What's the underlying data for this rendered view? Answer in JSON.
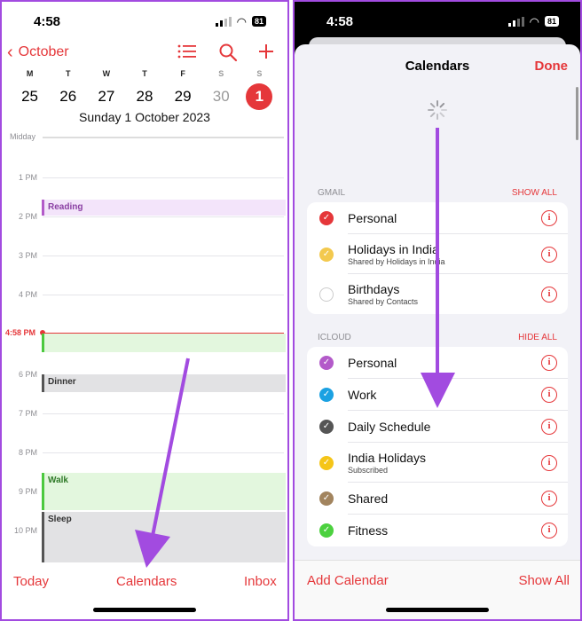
{
  "left": {
    "status": {
      "time": "4:58",
      "battery": "81"
    },
    "nav": {
      "back_label": "October",
      "icons": [
        "list-icon",
        "search-icon",
        "plus-icon"
      ]
    },
    "week": {
      "letters": [
        "M",
        "T",
        "W",
        "T",
        "F",
        "S",
        "S"
      ],
      "days": [
        "25",
        "26",
        "27",
        "28",
        "29",
        "30",
        "1"
      ],
      "selected_index": 6,
      "date_label": "Sunday  1 October 2023"
    },
    "timeline": {
      "hours": [
        "Midday",
        "1 PM",
        "2 PM",
        "3 PM",
        "4 PM",
        "5 PM",
        "6 PM",
        "7 PM",
        "8 PM",
        "9 PM",
        "10 PM"
      ],
      "now_label": "4:58 PM",
      "events": [
        {
          "title": "Reading",
          "color": "#b35ac9",
          "bg": "#f3e4fa"
        },
        {
          "title": "",
          "color": "#4cc93f",
          "bg": "#e3f7de"
        },
        {
          "title": "Dinner",
          "color": "#555555",
          "bg": "#e2e2e4"
        },
        {
          "title": "Walk",
          "color": "#4cc93f",
          "bg": "#e3f7de"
        },
        {
          "title": "Sleep",
          "color": "#555555",
          "bg": "#e2e2e4"
        }
      ]
    },
    "tabbar": {
      "today": "Today",
      "calendars": "Calendars",
      "inbox": "Inbox"
    }
  },
  "right": {
    "status": {
      "time": "4:58",
      "battery": "81"
    },
    "sheet": {
      "title": "Calendars",
      "done": "Done",
      "sections": [
        {
          "name": "GMAIL",
          "action": "SHOW ALL",
          "items": [
            {
              "title": "Personal",
              "subtitle": "",
              "color": "#e5373a",
              "checked": true
            },
            {
              "title": "Holidays in India",
              "subtitle": "Shared by Holidays in India",
              "color": "#f3c94e",
              "checked": true
            },
            {
              "title": "Birthdays",
              "subtitle": "Shared by Contacts",
              "color": "#cccccc",
              "checked": false
            }
          ]
        },
        {
          "name": "ICLOUD",
          "action": "HIDE ALL",
          "items": [
            {
              "title": "Personal",
              "subtitle": "",
              "color": "#b35ac9",
              "checked": true
            },
            {
              "title": "Work",
              "subtitle": "",
              "color": "#1ba1e2",
              "checked": true
            },
            {
              "title": "Daily Schedule",
              "subtitle": "",
              "color": "#555555",
              "checked": true
            },
            {
              "title": "India Holidays",
              "subtitle": "Subscribed",
              "color": "#f5c518",
              "checked": true
            },
            {
              "title": "Shared",
              "subtitle": "",
              "color": "#a2845e",
              "checked": true
            },
            {
              "title": "Fitness",
              "subtitle": "",
              "color": "#4cd13f",
              "checked": true
            }
          ]
        }
      ],
      "footer": {
        "add": "Add Calendar",
        "show_all": "Show All"
      }
    }
  },
  "annotation": {
    "arrow_color": "#a24be0"
  }
}
